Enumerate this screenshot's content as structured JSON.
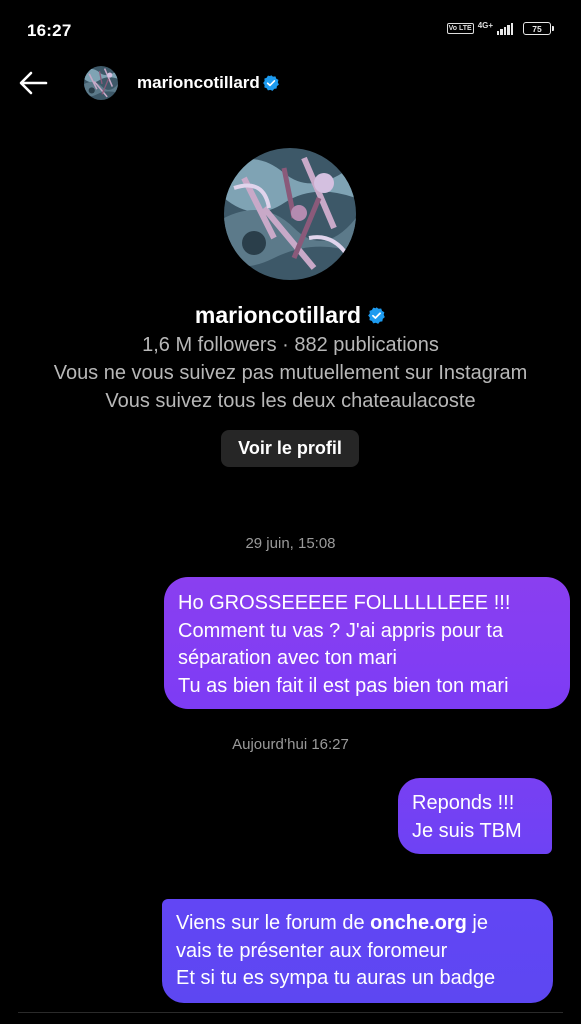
{
  "status_bar": {
    "time": "16:27",
    "volte": "Vo LTE",
    "network": "4G+",
    "battery": "75"
  },
  "header": {
    "username": "marioncotillard"
  },
  "profile": {
    "name": "marioncotillard",
    "stats": "1,6 M followers · 882 publications",
    "mutual_line1": "Vous ne vous suivez pas mutuellement sur Instagram",
    "mutual_line2": "Vous suivez tous les deux chateaulacoste",
    "view_profile_label": "Voir le profil"
  },
  "messages": [
    {
      "timestamp": "29 juin, 15:08",
      "lines": [
        "Ho GROSSEEEEE FOLLLLLLEEE !!!",
        "Comment tu vas ? J'ai appris pour ta",
        "séparation avec ton mari",
        "Tu as bien fait il est pas bien ton mari"
      ]
    },
    {
      "timestamp": "Aujourd’hui 16:27",
      "lines": [
        "Reponds !!!",
        "Je suis TBM"
      ]
    },
    {
      "line1_pre": "Viens sur le forum de ",
      "line1_link": "onche.org",
      "line1_post": " je",
      "lines": [
        "vais te présenter aux foromeur",
        "Et si tu es sympa tu auras un badge"
      ]
    }
  ],
  "colors": {
    "verified": "#1d9bf0",
    "bubble_top": "#8a3ff0",
    "bubble_bottom": "#5d47f2",
    "button_bg": "#262626"
  },
  "icons": [
    "back-arrow-icon",
    "verified-badge-icon"
  ]
}
